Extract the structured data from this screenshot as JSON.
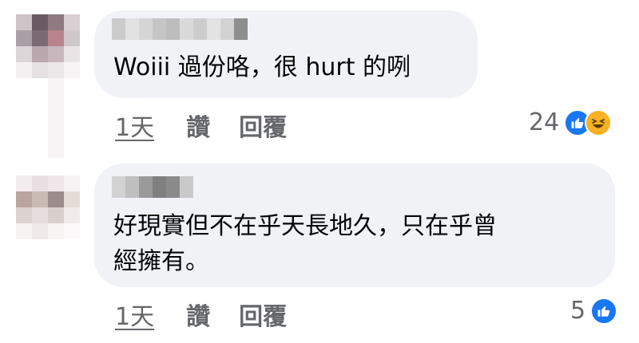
{
  "comments": [
    {
      "text_lines": [
        "Woiii 過份咯，很 hurt 的咧"
      ],
      "time": "1天",
      "like_label": "讚",
      "reply_label": "回覆",
      "reaction_count": "24",
      "reactions": [
        "like-icon",
        "haha-icon"
      ],
      "avatar_colors": [
        "#cdc4c7",
        "#6b5a63",
        "#8f7a82",
        "#d8d0d3",
        "#a9a0a6",
        "#7c6a72",
        "#b9838e",
        "#cfc8cb",
        "#ddd6d9",
        "#bba8ae",
        "#c7b7bc",
        "#e9e5e7",
        "#f3f0f1",
        "#e6e1e3",
        "#ece8ea",
        "#f6f4f5"
      ],
      "name_blur_colors": [
        "#cbcbcb",
        "#e2e2e2",
        "#d6d6d6",
        "#c5c5c5",
        "#bdbdbd",
        "#dadada",
        "#cdcdcd",
        "#e3e3e3",
        "#d2d2d2",
        "#8e8e8e"
      ]
    },
    {
      "text_lines": [
        "好現實但不在乎天長地久，只在乎曾",
        "經擁有。"
      ],
      "time": "1天",
      "like_label": "讚",
      "reply_label": "回覆",
      "reaction_count": "5",
      "reactions": [
        "like-icon"
      ],
      "avatar_colors": [
        "#f3ecee",
        "#e9dfe2",
        "#eee6e8",
        "#f6f1f2",
        "#b9a5a0",
        "#c8bcb4",
        "#9c8d8c",
        "#e5dcd8",
        "#ddd4d2",
        "#e6dedd",
        "#d9cfcc",
        "#f1ecea",
        "#f6f3f3",
        "#efe9e9",
        "#f7f4f4",
        "#fbf9f9"
      ],
      "name_blur_colors": [
        "#d2d2d2",
        "#bfbfbf",
        "#9a9a9a",
        "#7f7f7f",
        "#8a8a8a",
        "#c9c9c9"
      ]
    }
  ],
  "colors": {
    "bubble": "#f0f2f5",
    "secondary_text": "#65676b",
    "like_blue": "#1877f2",
    "haha_yellow": "#f7b125"
  }
}
